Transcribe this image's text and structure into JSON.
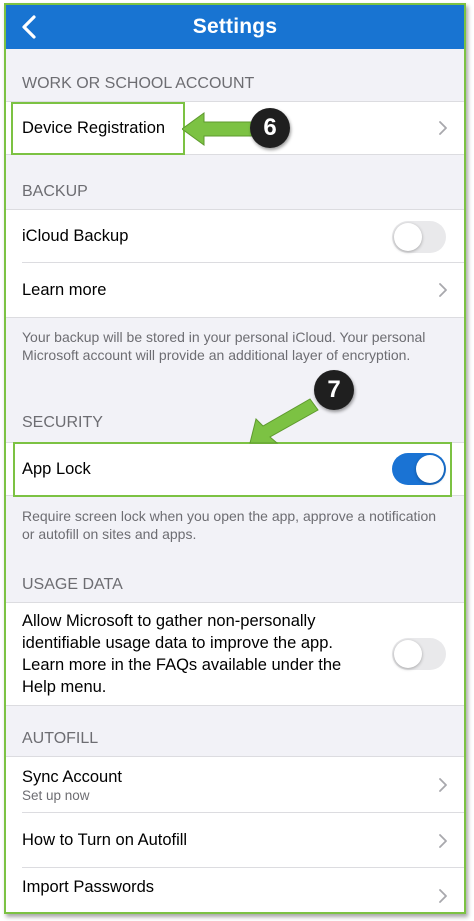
{
  "nav": {
    "title": "Settings",
    "back_icon": "chevron-left-icon"
  },
  "work_account": {
    "header": "WORK OR SCHOOL ACCOUNT",
    "device_registration": "Device Registration"
  },
  "backup": {
    "header": "BACKUP",
    "icloud_backup": {
      "label": "iCloud Backup",
      "enabled": false
    },
    "learn_more": "Learn more",
    "footnote": "Your backup will be stored in your personal iCloud. Your personal Microsoft account will provide an additional layer of encryption."
  },
  "security": {
    "header": "SECURITY",
    "app_lock": {
      "label": "App Lock",
      "enabled": true
    },
    "footnote": "Require screen lock when you open the app, approve a notification or autofill on sites and apps."
  },
  "usage_data": {
    "header": "USAGE DATA",
    "toggle": {
      "label": "Allow Microsoft to gather non-personally identifiable usage data to improve the app. Learn more in the FAQs available under the Help menu.",
      "enabled": false
    }
  },
  "autofill": {
    "header": "AUTOFILL",
    "sync_account": {
      "label": "Sync Account",
      "sub": "Set up now"
    },
    "how_to": "How to Turn on Autofill",
    "import_passwords": "Import Passwords"
  },
  "annotations": {
    "step_6": "6",
    "step_7": "7"
  },
  "colors": {
    "nav_blue": "#1874d2",
    "toggle_on": "#1a73d4",
    "highlight_green": "#7cc243",
    "callout_bg": "#1f1f1f"
  }
}
